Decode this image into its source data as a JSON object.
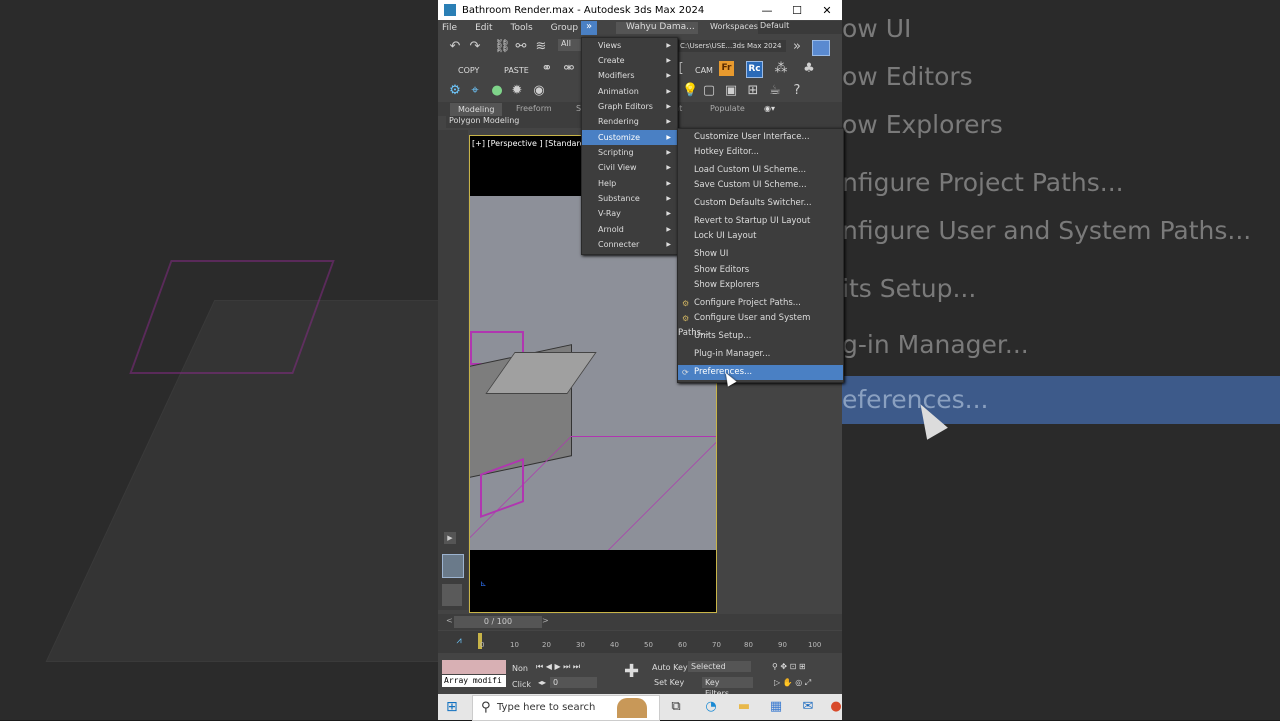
{
  "window": {
    "title": "Bathroom Render.max - Autodesk 3ds Max 2024",
    "minimize_glyph": "—",
    "maximize_glyph": "☐",
    "close_glyph": "✕"
  },
  "menubar": {
    "items": [
      "File",
      "Edit",
      "Tools",
      "Group"
    ],
    "more_glyph": "»",
    "user": "Wahyu Dama...",
    "workspaces_label": "Workspaces:",
    "workspaces_value": "Default"
  },
  "toolbar": {
    "selection_filter": "All",
    "project_path": "C:\\Users\\USE...3ds Max 2024",
    "copy_label": "COPY",
    "paste_label": "PASTE",
    "cam_label": "CAM",
    "f_badge": "Fr",
    "rc_badge": "Rc"
  },
  "ribbon": {
    "tabs": [
      "Modeling",
      "Freeform",
      "S",
      "nt",
      "Populate"
    ],
    "subpanel": "Polygon Modeling"
  },
  "viewport": {
    "label": "[+] [Perspective ] [Standard ] [E",
    "axis_glyph": "⊾"
  },
  "main_menu": {
    "items": [
      {
        "label": "Views"
      },
      {
        "label": "Create"
      },
      {
        "label": "Modifiers"
      },
      {
        "label": "Animation"
      },
      {
        "label": "Graph Editors"
      },
      {
        "label": "Rendering"
      },
      {
        "label": "Customize"
      },
      {
        "label": "Scripting"
      },
      {
        "label": "Civil View"
      },
      {
        "label": "Help"
      },
      {
        "label": "Substance"
      },
      {
        "label": "V-Ray"
      },
      {
        "label": "Arnold"
      },
      {
        "label": "Connecter"
      }
    ],
    "arrow_glyph": "▶"
  },
  "customize_menu": {
    "items": [
      {
        "label": "Customize User Interface..."
      },
      {
        "label": "Hotkey Editor..."
      },
      {
        "label": "Load Custom UI Scheme..."
      },
      {
        "label": "Save Custom UI Scheme..."
      },
      {
        "label": "Custom Defaults Switcher..."
      },
      {
        "label": "Revert to Startup UI Layout"
      },
      {
        "label": "Lock UI Layout"
      },
      {
        "label": "Show UI"
      },
      {
        "label": "Show Editors"
      },
      {
        "label": "Show Explorers"
      },
      {
        "label": "Configure Project Paths..."
      },
      {
        "label": "Configure User and System Paths..."
      },
      {
        "label": "Units Setup..."
      },
      {
        "label": "Plug-in Manager..."
      },
      {
        "label": "Preferences..."
      }
    ]
  },
  "zoomed": {
    "lines": [
      "ow UI",
      "ow Editors",
      "ow Explorers",
      "nfigure Project Paths...",
      "nfigure User and System Paths...",
      "its Setup...",
      "g-in Manager...",
      "eferences..."
    ]
  },
  "timeline": {
    "frame": "0 / 100",
    "prev_glyph": "<",
    "next_glyph": ">",
    "ticks": [
      "0",
      "10",
      "20",
      "30",
      "40",
      "50",
      "60",
      "70",
      "80",
      "90",
      "100"
    ]
  },
  "status": {
    "modifier_text": "Array modifi",
    "none_label": "Non",
    "click_label": "Click",
    "frame_value": "0",
    "auto_key": "Auto Key",
    "set_key": "Set Key",
    "selected": "Selected",
    "key_filters": "Key Filters..."
  },
  "taskbar": {
    "search_placeholder": "Type here to search",
    "search_icon_glyph": "⚲",
    "start_glyph": "⊞"
  }
}
